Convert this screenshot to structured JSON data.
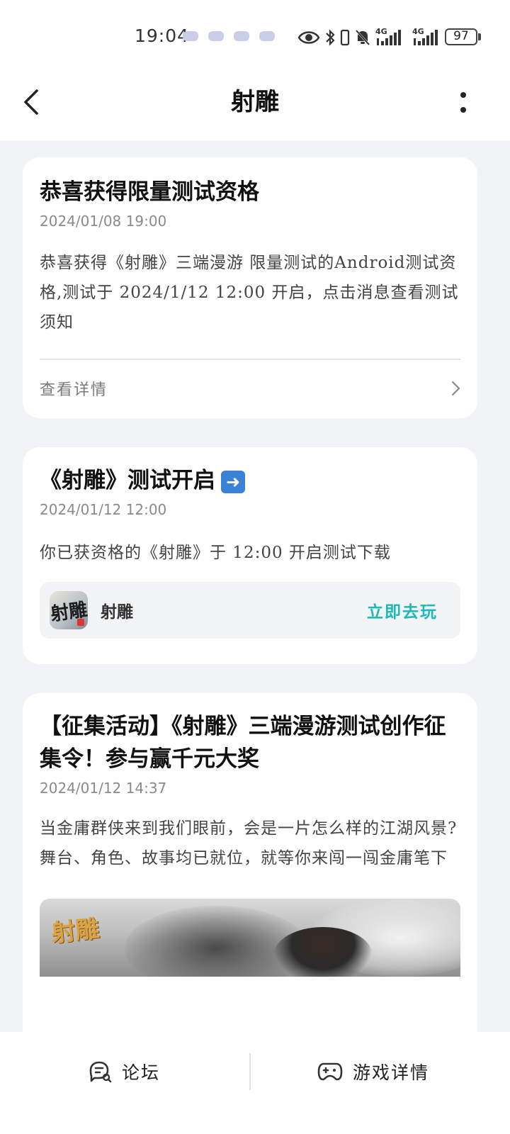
{
  "status_bar": {
    "time": "19:04",
    "network_1": "4G",
    "network_2": "4G",
    "battery": "97"
  },
  "header": {
    "title": "射雕"
  },
  "cards": [
    {
      "title": "恭喜获得限量测试资格",
      "date": "2024/01/08 19:00",
      "body": "恭喜获得《射雕》三端漫游 限量测试的Android测试资格,测试于 2024/1/12 12:00 开启，点击消息查看测试须知",
      "link_label": "查看详情"
    },
    {
      "title": "《射雕》测试开启",
      "title_emoji": "➡️",
      "date": "2024/01/12 12:00",
      "body": "你已获资格的《射雕》于 12:00 开启测试下载",
      "game_name": "射雕",
      "game_icon_text": "射雕",
      "play_label": "立即去玩"
    },
    {
      "title": "【征集活动】《射雕》三端漫游测试创作征集令！参与赢千元大奖",
      "date": "2024/01/12 14:37",
      "body_lines": [
        "当金庸群侠来到我们眼前，会是一片怎么样的江湖风景?",
        "舞台、角色、故事均已就位，就等你来闯一闯金庸笔下"
      ],
      "banner_logo": "射雕"
    }
  ],
  "bottom_nav": {
    "forum_label": "论坛",
    "game_detail_label": "游戏详情"
  },
  "colors": {
    "accent_teal": "#1fb8b8",
    "page_bg": "#f2f3f5"
  }
}
